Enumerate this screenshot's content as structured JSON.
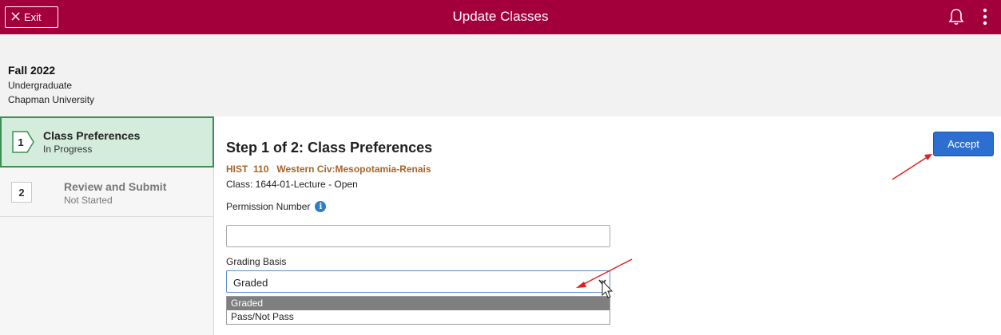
{
  "header": {
    "exit_label": "Exit",
    "title": "Update Classes",
    "icons": [
      "close-icon",
      "bell-icon",
      "more-vertical-icon"
    ]
  },
  "term": {
    "name": "Fall 2022",
    "career": "Undergraduate",
    "institution": "Chapman University"
  },
  "steps": [
    {
      "number": "1",
      "title": "Class Preferences",
      "status": "In Progress"
    },
    {
      "number": "2",
      "title": "Review and Submit",
      "status": "Not Started"
    }
  ],
  "main": {
    "title": "Step 1 of 2: Class Preferences",
    "course": "HIST  110   Western Civ:Mesopotamia-Renais",
    "class_info": "Class: 1644-01-Lecture - Open",
    "permission_label": "Permission Number",
    "permission_value": "",
    "grading_label": "Grading Basis",
    "grading_value": "Graded",
    "grading_options": [
      "Graded",
      "Pass/Not Pass"
    ],
    "accept_label": "Accept"
  },
  "colors": {
    "brand": "#a3003b",
    "active_step_bg": "#d3ecdc",
    "active_step_border": "#3c8e52",
    "accept_button": "#2c6fd0",
    "course_text": "#a5642a",
    "annotation_arrow": "#e02020"
  }
}
